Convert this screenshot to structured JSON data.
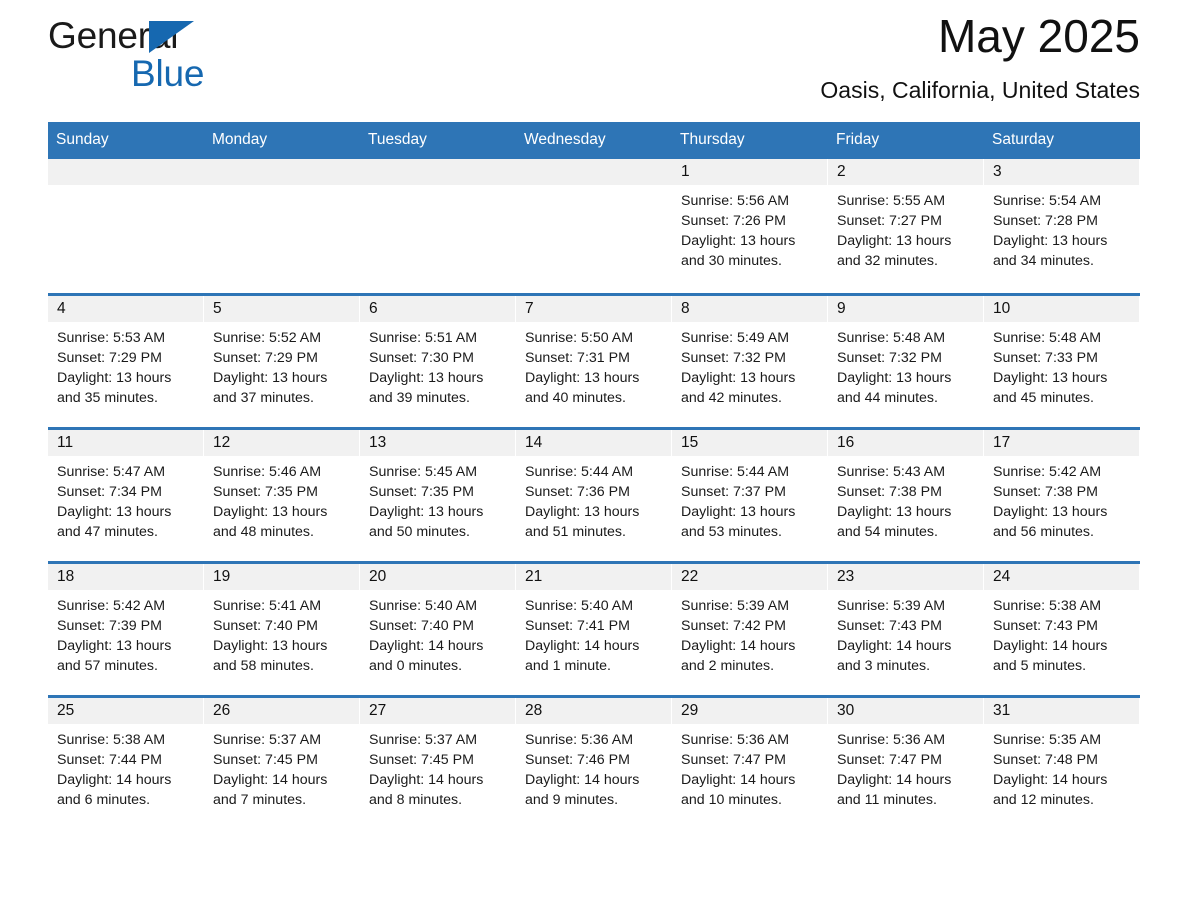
{
  "brand": {
    "word1": "General",
    "word2": "Blue",
    "triangle_color": "#1668b0"
  },
  "header": {
    "month_title": "May 2025",
    "location": "Oasis, California, United States"
  },
  "theme": {
    "accent_blue": "#2e75b6",
    "day_band_gray": "#f1f1f1",
    "header_text": "#ffffff"
  },
  "calendar": {
    "weekdays": [
      "Sunday",
      "Monday",
      "Tuesday",
      "Wednesday",
      "Thursday",
      "Friday",
      "Saturday"
    ],
    "weeks": [
      [
        {
          "empty": true
        },
        {
          "empty": true
        },
        {
          "empty": true
        },
        {
          "empty": true
        },
        {
          "date": "1",
          "sunrise": "Sunrise: 5:56 AM",
          "sunset": "Sunset: 7:26 PM",
          "daylight_l1": "Daylight: 13 hours",
          "daylight_l2": "and 30 minutes."
        },
        {
          "date": "2",
          "sunrise": "Sunrise: 5:55 AM",
          "sunset": "Sunset: 7:27 PM",
          "daylight_l1": "Daylight: 13 hours",
          "daylight_l2": "and 32 minutes."
        },
        {
          "date": "3",
          "sunrise": "Sunrise: 5:54 AM",
          "sunset": "Sunset: 7:28 PM",
          "daylight_l1": "Daylight: 13 hours",
          "daylight_l2": "and 34 minutes."
        }
      ],
      [
        {
          "date": "4",
          "sunrise": "Sunrise: 5:53 AM",
          "sunset": "Sunset: 7:29 PM",
          "daylight_l1": "Daylight: 13 hours",
          "daylight_l2": "and 35 minutes."
        },
        {
          "date": "5",
          "sunrise": "Sunrise: 5:52 AM",
          "sunset": "Sunset: 7:29 PM",
          "daylight_l1": "Daylight: 13 hours",
          "daylight_l2": "and 37 minutes."
        },
        {
          "date": "6",
          "sunrise": "Sunrise: 5:51 AM",
          "sunset": "Sunset: 7:30 PM",
          "daylight_l1": "Daylight: 13 hours",
          "daylight_l2": "and 39 minutes."
        },
        {
          "date": "7",
          "sunrise": "Sunrise: 5:50 AM",
          "sunset": "Sunset: 7:31 PM",
          "daylight_l1": "Daylight: 13 hours",
          "daylight_l2": "and 40 minutes."
        },
        {
          "date": "8",
          "sunrise": "Sunrise: 5:49 AM",
          "sunset": "Sunset: 7:32 PM",
          "daylight_l1": "Daylight: 13 hours",
          "daylight_l2": "and 42 minutes."
        },
        {
          "date": "9",
          "sunrise": "Sunrise: 5:48 AM",
          "sunset": "Sunset: 7:32 PM",
          "daylight_l1": "Daylight: 13 hours",
          "daylight_l2": "and 44 minutes."
        },
        {
          "date": "10",
          "sunrise": "Sunrise: 5:48 AM",
          "sunset": "Sunset: 7:33 PM",
          "daylight_l1": "Daylight: 13 hours",
          "daylight_l2": "and 45 minutes."
        }
      ],
      [
        {
          "date": "11",
          "sunrise": "Sunrise: 5:47 AM",
          "sunset": "Sunset: 7:34 PM",
          "daylight_l1": "Daylight: 13 hours",
          "daylight_l2": "and 47 minutes."
        },
        {
          "date": "12",
          "sunrise": "Sunrise: 5:46 AM",
          "sunset": "Sunset: 7:35 PM",
          "daylight_l1": "Daylight: 13 hours",
          "daylight_l2": "and 48 minutes."
        },
        {
          "date": "13",
          "sunrise": "Sunrise: 5:45 AM",
          "sunset": "Sunset: 7:35 PM",
          "daylight_l1": "Daylight: 13 hours",
          "daylight_l2": "and 50 minutes."
        },
        {
          "date": "14",
          "sunrise": "Sunrise: 5:44 AM",
          "sunset": "Sunset: 7:36 PM",
          "daylight_l1": "Daylight: 13 hours",
          "daylight_l2": "and 51 minutes."
        },
        {
          "date": "15",
          "sunrise": "Sunrise: 5:44 AM",
          "sunset": "Sunset: 7:37 PM",
          "daylight_l1": "Daylight: 13 hours",
          "daylight_l2": "and 53 minutes."
        },
        {
          "date": "16",
          "sunrise": "Sunrise: 5:43 AM",
          "sunset": "Sunset: 7:38 PM",
          "daylight_l1": "Daylight: 13 hours",
          "daylight_l2": "and 54 minutes."
        },
        {
          "date": "17",
          "sunrise": "Sunrise: 5:42 AM",
          "sunset": "Sunset: 7:38 PM",
          "daylight_l1": "Daylight: 13 hours",
          "daylight_l2": "and 56 minutes."
        }
      ],
      [
        {
          "date": "18",
          "sunrise": "Sunrise: 5:42 AM",
          "sunset": "Sunset: 7:39 PM",
          "daylight_l1": "Daylight: 13 hours",
          "daylight_l2": "and 57 minutes."
        },
        {
          "date": "19",
          "sunrise": "Sunrise: 5:41 AM",
          "sunset": "Sunset: 7:40 PM",
          "daylight_l1": "Daylight: 13 hours",
          "daylight_l2": "and 58 minutes."
        },
        {
          "date": "20",
          "sunrise": "Sunrise: 5:40 AM",
          "sunset": "Sunset: 7:40 PM",
          "daylight_l1": "Daylight: 14 hours",
          "daylight_l2": "and 0 minutes."
        },
        {
          "date": "21",
          "sunrise": "Sunrise: 5:40 AM",
          "sunset": "Sunset: 7:41 PM",
          "daylight_l1": "Daylight: 14 hours",
          "daylight_l2": "and 1 minute."
        },
        {
          "date": "22",
          "sunrise": "Sunrise: 5:39 AM",
          "sunset": "Sunset: 7:42 PM",
          "daylight_l1": "Daylight: 14 hours",
          "daylight_l2": "and 2 minutes."
        },
        {
          "date": "23",
          "sunrise": "Sunrise: 5:39 AM",
          "sunset": "Sunset: 7:43 PM",
          "daylight_l1": "Daylight: 14 hours",
          "daylight_l2": "and 3 minutes."
        },
        {
          "date": "24",
          "sunrise": "Sunrise: 5:38 AM",
          "sunset": "Sunset: 7:43 PM",
          "daylight_l1": "Daylight: 14 hours",
          "daylight_l2": "and 5 minutes."
        }
      ],
      [
        {
          "date": "25",
          "sunrise": "Sunrise: 5:38 AM",
          "sunset": "Sunset: 7:44 PM",
          "daylight_l1": "Daylight: 14 hours",
          "daylight_l2": "and 6 minutes."
        },
        {
          "date": "26",
          "sunrise": "Sunrise: 5:37 AM",
          "sunset": "Sunset: 7:45 PM",
          "daylight_l1": "Daylight: 14 hours",
          "daylight_l2": "and 7 minutes."
        },
        {
          "date": "27",
          "sunrise": "Sunrise: 5:37 AM",
          "sunset": "Sunset: 7:45 PM",
          "daylight_l1": "Daylight: 14 hours",
          "daylight_l2": "and 8 minutes."
        },
        {
          "date": "28",
          "sunrise": "Sunrise: 5:36 AM",
          "sunset": "Sunset: 7:46 PM",
          "daylight_l1": "Daylight: 14 hours",
          "daylight_l2": "and 9 minutes."
        },
        {
          "date": "29",
          "sunrise": "Sunrise: 5:36 AM",
          "sunset": "Sunset: 7:47 PM",
          "daylight_l1": "Daylight: 14 hours",
          "daylight_l2": "and 10 minutes."
        },
        {
          "date": "30",
          "sunrise": "Sunrise: 5:36 AM",
          "sunset": "Sunset: 7:47 PM",
          "daylight_l1": "Daylight: 14 hours",
          "daylight_l2": "and 11 minutes."
        },
        {
          "date": "31",
          "sunrise": "Sunrise: 5:35 AM",
          "sunset": "Sunset: 7:48 PM",
          "daylight_l1": "Daylight: 14 hours",
          "daylight_l2": "and 12 minutes."
        }
      ]
    ]
  }
}
